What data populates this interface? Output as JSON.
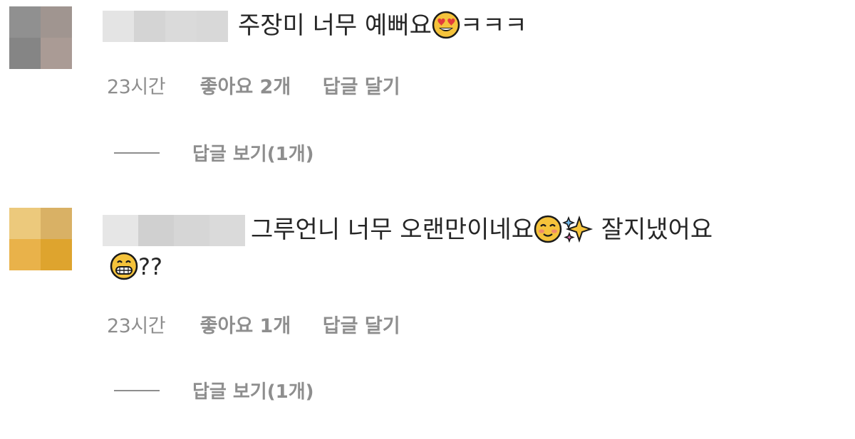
{
  "comments": [
    {
      "text": "주장미 너무 예뻐요",
      "suffix": "ㅋㅋㅋ",
      "emoji": "heart-eyes-emoji",
      "time": "23시간",
      "likes": "좋아요 2개",
      "reply": "답글 달기",
      "view_replies": "답글 보기(1개)",
      "avatar_colors": [
        "#909090",
        "#a09590",
        "#858585",
        "#aa9b95"
      ],
      "username_colors": [
        "#e4e4e4",
        "#d4d4d4",
        "#dadada",
        "#d8d8d8"
      ]
    },
    {
      "text_line1": "그루언니 너무 오랜만이네요",
      "text_after_sparkle": " 잘지냈어요",
      "text_line2_suffix": "??",
      "emojis": [
        "blush-emoji",
        "sparkles-emoji",
        "grin-emoji"
      ],
      "time": "23시간",
      "likes": "좋아요 1개",
      "reply": "답글 달기",
      "view_replies": "답글 보기(1개)",
      "avatar_colors": [
        "#ecc97c",
        "#d9b165",
        "#e9b24a",
        "#dea42e"
      ],
      "username_colors": [
        "#e6e6e6",
        "#d0d0d0",
        "#d6d6d6",
        "#dadada"
      ]
    }
  ]
}
